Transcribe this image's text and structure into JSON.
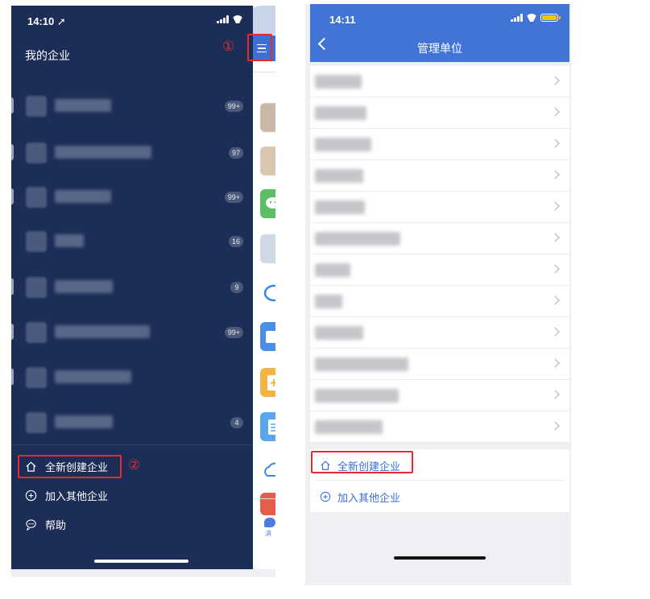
{
  "left": {
    "status": {
      "time": "14:10 ➚"
    },
    "drawer_title": "我的企业",
    "orgs": [
      {
        "badge": "99+"
      },
      {
        "badge": "97"
      },
      {
        "badge": "99+"
      },
      {
        "badge": "16"
      },
      {
        "badge": "9"
      },
      {
        "badge": "99+"
      },
      {
        "badge": ""
      },
      {
        "badge": "4"
      }
    ],
    "actions": {
      "create": "全新创建企业",
      "join": "加入其他企业",
      "help": "帮助"
    },
    "annotations": {
      "step1": "①",
      "step2": "②"
    },
    "peek_footer_label": "消"
  },
  "right": {
    "status": {
      "time": "14:11"
    },
    "nav_title": "管理单位",
    "units_count_note": "",
    "actions": {
      "create": "全新创建企业",
      "join": "加入其他企业"
    }
  },
  "colors": {
    "drawer_bg": "#1c2d57",
    "brand_blue": "#4174d6",
    "annotation_red": "#e52b2b"
  },
  "icons": {
    "home": "home-icon",
    "plus_circle": "plus-circle-icon",
    "help": "help-bubble-icon",
    "menu": "menu-icon",
    "back": "back-chevron-icon",
    "chevron": "chevron-right-icon"
  }
}
